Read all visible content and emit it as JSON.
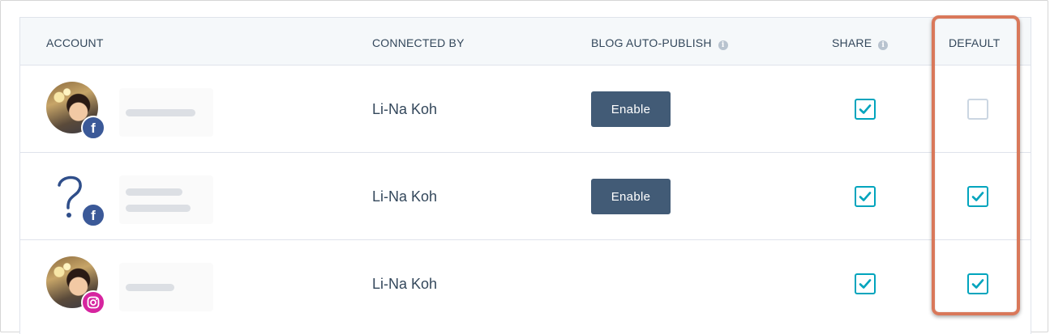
{
  "table": {
    "headers": {
      "account": "ACCOUNT",
      "connected_by": "CONNECTED BY",
      "blog_auto_publish": "BLOG AUTO-PUBLISH",
      "share": "SHARE",
      "default": "DEFAULT"
    },
    "rows": [
      {
        "network": "facebook-icon",
        "connected_by": "Li-Na Koh",
        "blog_button": "Enable",
        "share_checked": true,
        "default_checked": false
      },
      {
        "network": "facebook-icon",
        "connected_by": "Li-Na Koh",
        "blog_button": "Enable",
        "share_checked": true,
        "default_checked": true
      },
      {
        "network": "instagram-icon",
        "connected_by": "Li-Na Koh",
        "blog_button": "",
        "share_checked": true,
        "default_checked": true
      }
    ]
  },
  "colors": {
    "header_bg": "#f5f8fa",
    "checkbox_accent": "#00a4bd",
    "button_bg": "#425b76",
    "highlight": "#d9785a",
    "facebook": "#3b5998",
    "instagram": "#d6249f"
  }
}
